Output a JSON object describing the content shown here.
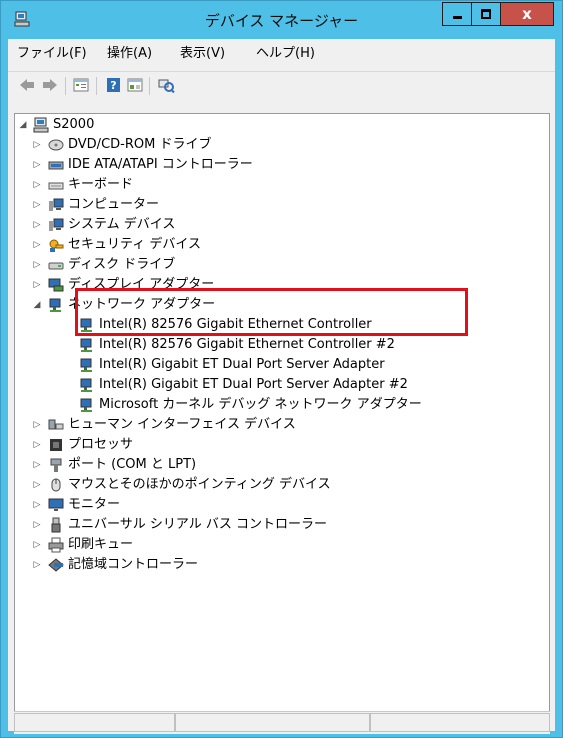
{
  "window": {
    "title": "デバイス マネージャー",
    "close_label": "x",
    "colors": {
      "frame": "#4ec0e8",
      "close": "#c7524a",
      "highlight": "#e0101a"
    }
  },
  "menu": [
    {
      "label": "ファイル(F)"
    },
    {
      "label": "操作(A)"
    },
    {
      "label": "表示(V)"
    },
    {
      "label": "ヘルプ(H)"
    }
  ],
  "toolbar": {
    "buttons": [
      "back-icon",
      "forward-icon",
      "properties-icon",
      "help-icon",
      "update-driver-icon",
      "scan-hardware-icon"
    ]
  },
  "tree": {
    "root": {
      "label": "S2000",
      "icon": "computer-icon",
      "expanded": true
    },
    "categories": [
      {
        "label": "DVD/CD-ROM ドライブ",
        "icon": "dvd-drive-icon"
      },
      {
        "label": "IDE ATA/ATAPI コントローラー",
        "icon": "ide-controller-icon"
      },
      {
        "label": "キーボード",
        "icon": "keyboard-icon"
      },
      {
        "label": "コンピューター",
        "icon": "monitor-icon"
      },
      {
        "label": "システム デバイス",
        "icon": "system-device-icon"
      },
      {
        "label": "セキュリティ デバイス",
        "icon": "security-device-icon"
      },
      {
        "label": "ディスク ドライブ",
        "icon": "disk-drive-icon"
      },
      {
        "label": "ディスプレイ アダプター",
        "icon": "display-adapter-icon"
      },
      {
        "label": "ネットワーク アダプター",
        "icon": "network-adapter-icon",
        "expanded": true
      }
    ],
    "network_adapters": [
      {
        "label": "Intel(R) 82576 Gigabit Ethernet Controller"
      },
      {
        "label": "Intel(R) 82576 Gigabit Ethernet Controller #2"
      },
      {
        "label": "Intel(R) Gigabit ET Dual Port Server Adapter"
      },
      {
        "label": "Intel(R) Gigabit ET Dual Port Server Adapter #2"
      },
      {
        "label": "Microsoft カーネル デバッグ ネットワーク アダプター"
      }
    ],
    "categories_after": [
      {
        "label": "ヒューマン インターフェイス デバイス",
        "icon": "hid-icon"
      },
      {
        "label": "プロセッサ",
        "icon": "processor-icon"
      },
      {
        "label": "ポート (COM と LPT)",
        "icon": "port-icon"
      },
      {
        "label": "マウスとそのほかのポインティング デバイス",
        "icon": "mouse-icon"
      },
      {
        "label": "モニター",
        "icon": "monitor-icon"
      },
      {
        "label": "ユニバーサル シリアル バス コントローラー",
        "icon": "usb-icon"
      },
      {
        "label": "印刷キュー",
        "icon": "printer-icon"
      },
      {
        "label": "記憶域コントローラー",
        "icon": "storage-controller-icon"
      }
    ]
  }
}
